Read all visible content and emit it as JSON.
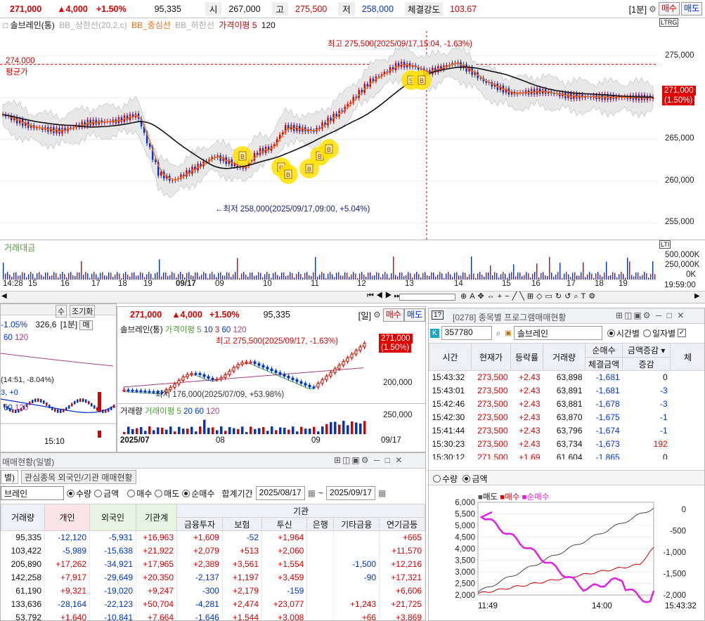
{
  "topbar": {
    "price": "271,000",
    "change": "▲4,000",
    "pct": "+1.50%",
    "volume": "95,335",
    "open_lbl": "시",
    "open": "267,000",
    "high_lbl": "고",
    "high": "275,500",
    "low_lbl": "저",
    "low": "258,000",
    "strength_lbl": "체결강도",
    "strength": "103.67",
    "interval": "[1분]",
    "buy": "매수",
    "sell": "매도"
  },
  "main_chart": {
    "legend_name": "솔브레인(통)",
    "bb_upper": "BB_상한선(20,2,c)",
    "bb_mid": "BB_중심선",
    "bb_lower": "BB_하한선",
    "price_ma": "가격이평 5",
    "ma120": "120",
    "max_note": "최고 275,500(2025/09/17,15:04, -1.63%)",
    "min_note": "←최저 258,000(2025/09/17,09:00, +5.04%)",
    "avg_value": "274,000",
    "avg_label": "평균가",
    "current_tag": "271,000",
    "current_pct": "(1.50%)",
    "yticks": [
      "275,000",
      "270,000",
      "265,000",
      "260,000",
      "255,000"
    ],
    "vol_label": "거래대금",
    "vol_ticks": [
      "500,000K",
      "250,000K",
      "0K"
    ],
    "xticks": [
      "14:28",
      "15",
      "16",
      "17",
      "18",
      "19",
      "09/17",
      "09",
      "10",
      "11",
      "12",
      "13",
      "14",
      "15",
      "16",
      "17",
      "18",
      "19"
    ],
    "time_now": "19:59:00"
  },
  "mini_left": {
    "pct": "-1.05%",
    "price": "326,6",
    "interval": "[1분]",
    "buy": "매",
    "ma60": "60",
    "ma120": "120",
    "note": "(14:51, -8.04%)",
    "note2": "3, +0",
    "x1": "15:10",
    "tab_su": "수",
    "tab_jo": "조기화"
  },
  "mid_chart": {
    "price": "271,000",
    "change": "▲4,000",
    "pct": "+1.50%",
    "volume": "95,335",
    "interval": "[일]",
    "buy": "매수",
    "sell": "매도",
    "legend_name": "솔브레인(통)",
    "price_ma": "가격이평 5",
    "m10": "10",
    "m3": "3",
    "m60": "60",
    "m120": "120",
    "max_note": "최고 275,500(2025/09/17, -1.63%)",
    "min_note": "최저 176,000(2025/07/09, +53.98%)",
    "tag": "271,000",
    "tag_pct": "(1.50%)",
    "yticks": [
      "250,000",
      "200,000"
    ],
    "vol_legend": "거래량",
    "vol_ma": "거래이평 5",
    "v20": "20",
    "v60": "60",
    "v120": "120",
    "vol_tick": "250,000",
    "x_month": "2025/07",
    "x08": "08",
    "x09": "09",
    "x_end": "09/17"
  },
  "right_panel": {
    "title": "[0278] 종목별 프로그램매매현황",
    "code": "357780",
    "name": "솔브레인",
    "opt_time": "시간별",
    "opt_day": "일자별",
    "headers": [
      "시간",
      "현재가",
      "등락률",
      "거래량",
      "순매수",
      "체결금액",
      "증감",
      "체"
    ],
    "net_select": "금액증감",
    "rows": [
      [
        "15:43:32",
        "273,500",
        "+2.43",
        "63,898",
        "-1,681",
        "0"
      ],
      [
        "15:43:01",
        "273,500",
        "+2.43",
        "63,891",
        "-1,681",
        "-3"
      ],
      [
        "15:42:46",
        "273,500",
        "+2.43",
        "63,881",
        "-1,678",
        "-3"
      ],
      [
        "15:42:30",
        "273,500",
        "+2.43",
        "63,870",
        "-1,675",
        "-1"
      ],
      [
        "15:41:44",
        "273,500",
        "+2.43",
        "63,796",
        "-1,674",
        "-1"
      ],
      [
        "15:30:23",
        "273,500",
        "+2.43",
        "63,734",
        "-1,673",
        "192"
      ],
      [
        "15:30:12",
        "271,500",
        "+1.69",
        "61,604",
        "-1,865",
        "0"
      ]
    ],
    "opt_qty": "수량",
    "opt_amt": "금액",
    "chart_legend": [
      "매도",
      "매수",
      "순매수"
    ],
    "left_ticks": [
      "6,000",
      "5,500",
      "5,000",
      "4,500",
      "4,000",
      "3,500",
      "3,000",
      "2,500",
      "2,000"
    ],
    "right_ticks": [
      "0",
      "-500",
      "-1,000",
      "-1,500",
      "-2,000"
    ],
    "x_start": "11:49",
    "x_mid": "14:00",
    "x_end": "15:43:32"
  },
  "investor_panel": {
    "title": "매매현황(일별)",
    "tab1": "별)",
    "tab2": "관심종목 외국인/기관 매매현황",
    "name": "브레인",
    "opt_qty": "수량",
    "opt_amt": "금액",
    "opt_buy": "매수",
    "opt_sell": "매도",
    "opt_net": "순매수",
    "period_lbl": "합계기간",
    "date_from": "2025/08/17",
    "date_to": "2025/09/17",
    "inst_header": "기관",
    "headers": [
      "거래량",
      "개인",
      "외국인",
      "기관계",
      "금융투자",
      "보험",
      "투신",
      "은행",
      "기타금융",
      "연기금등"
    ],
    "rows": [
      [
        "95,335",
        "-12,120",
        "-5,931",
        "+16,963",
        "+1,609",
        "-52",
        "+1,964",
        "",
        "",
        "+665"
      ],
      [
        "103,422",
        "-5,989",
        "-15,638",
        "+21,922",
        "+2,079",
        "+513",
        "+2,060",
        "",
        "",
        "+11,570"
      ],
      [
        "205,890",
        "+17,262",
        "-34,921",
        "+17,965",
        "+2,389",
        "+3,561",
        "+1,554",
        "",
        "-1,500",
        "+12,216"
      ],
      [
        "142,258",
        "+7,917",
        "-29,649",
        "+20,350",
        "-2,137",
        "+1,197",
        "+3,459",
        "",
        "-90",
        "+17,321"
      ],
      [
        "61,190",
        "+9,321",
        "-19,020",
        "+9,247",
        "-300",
        "+2,179",
        "-159",
        "",
        "",
        "+6,606"
      ],
      [
        "133,636",
        "-28,164",
        "-22,123",
        "+50,704",
        "-4,281",
        "+2,474",
        "+23,077",
        "",
        "+1,243",
        "+21,725"
      ],
      [
        "53,792",
        "+1,640",
        "-10,841",
        "+7,664",
        "-1,646",
        "+1,544",
        "+3,008",
        "",
        "+66",
        "+3,869"
      ]
    ]
  },
  "colors": {
    "up": "#d70000",
    "down": "#0033cc",
    "bb": "#d9d9d9",
    "ma5": "#f07020",
    "ma120": "#111111",
    "net": "#e020e0"
  }
}
